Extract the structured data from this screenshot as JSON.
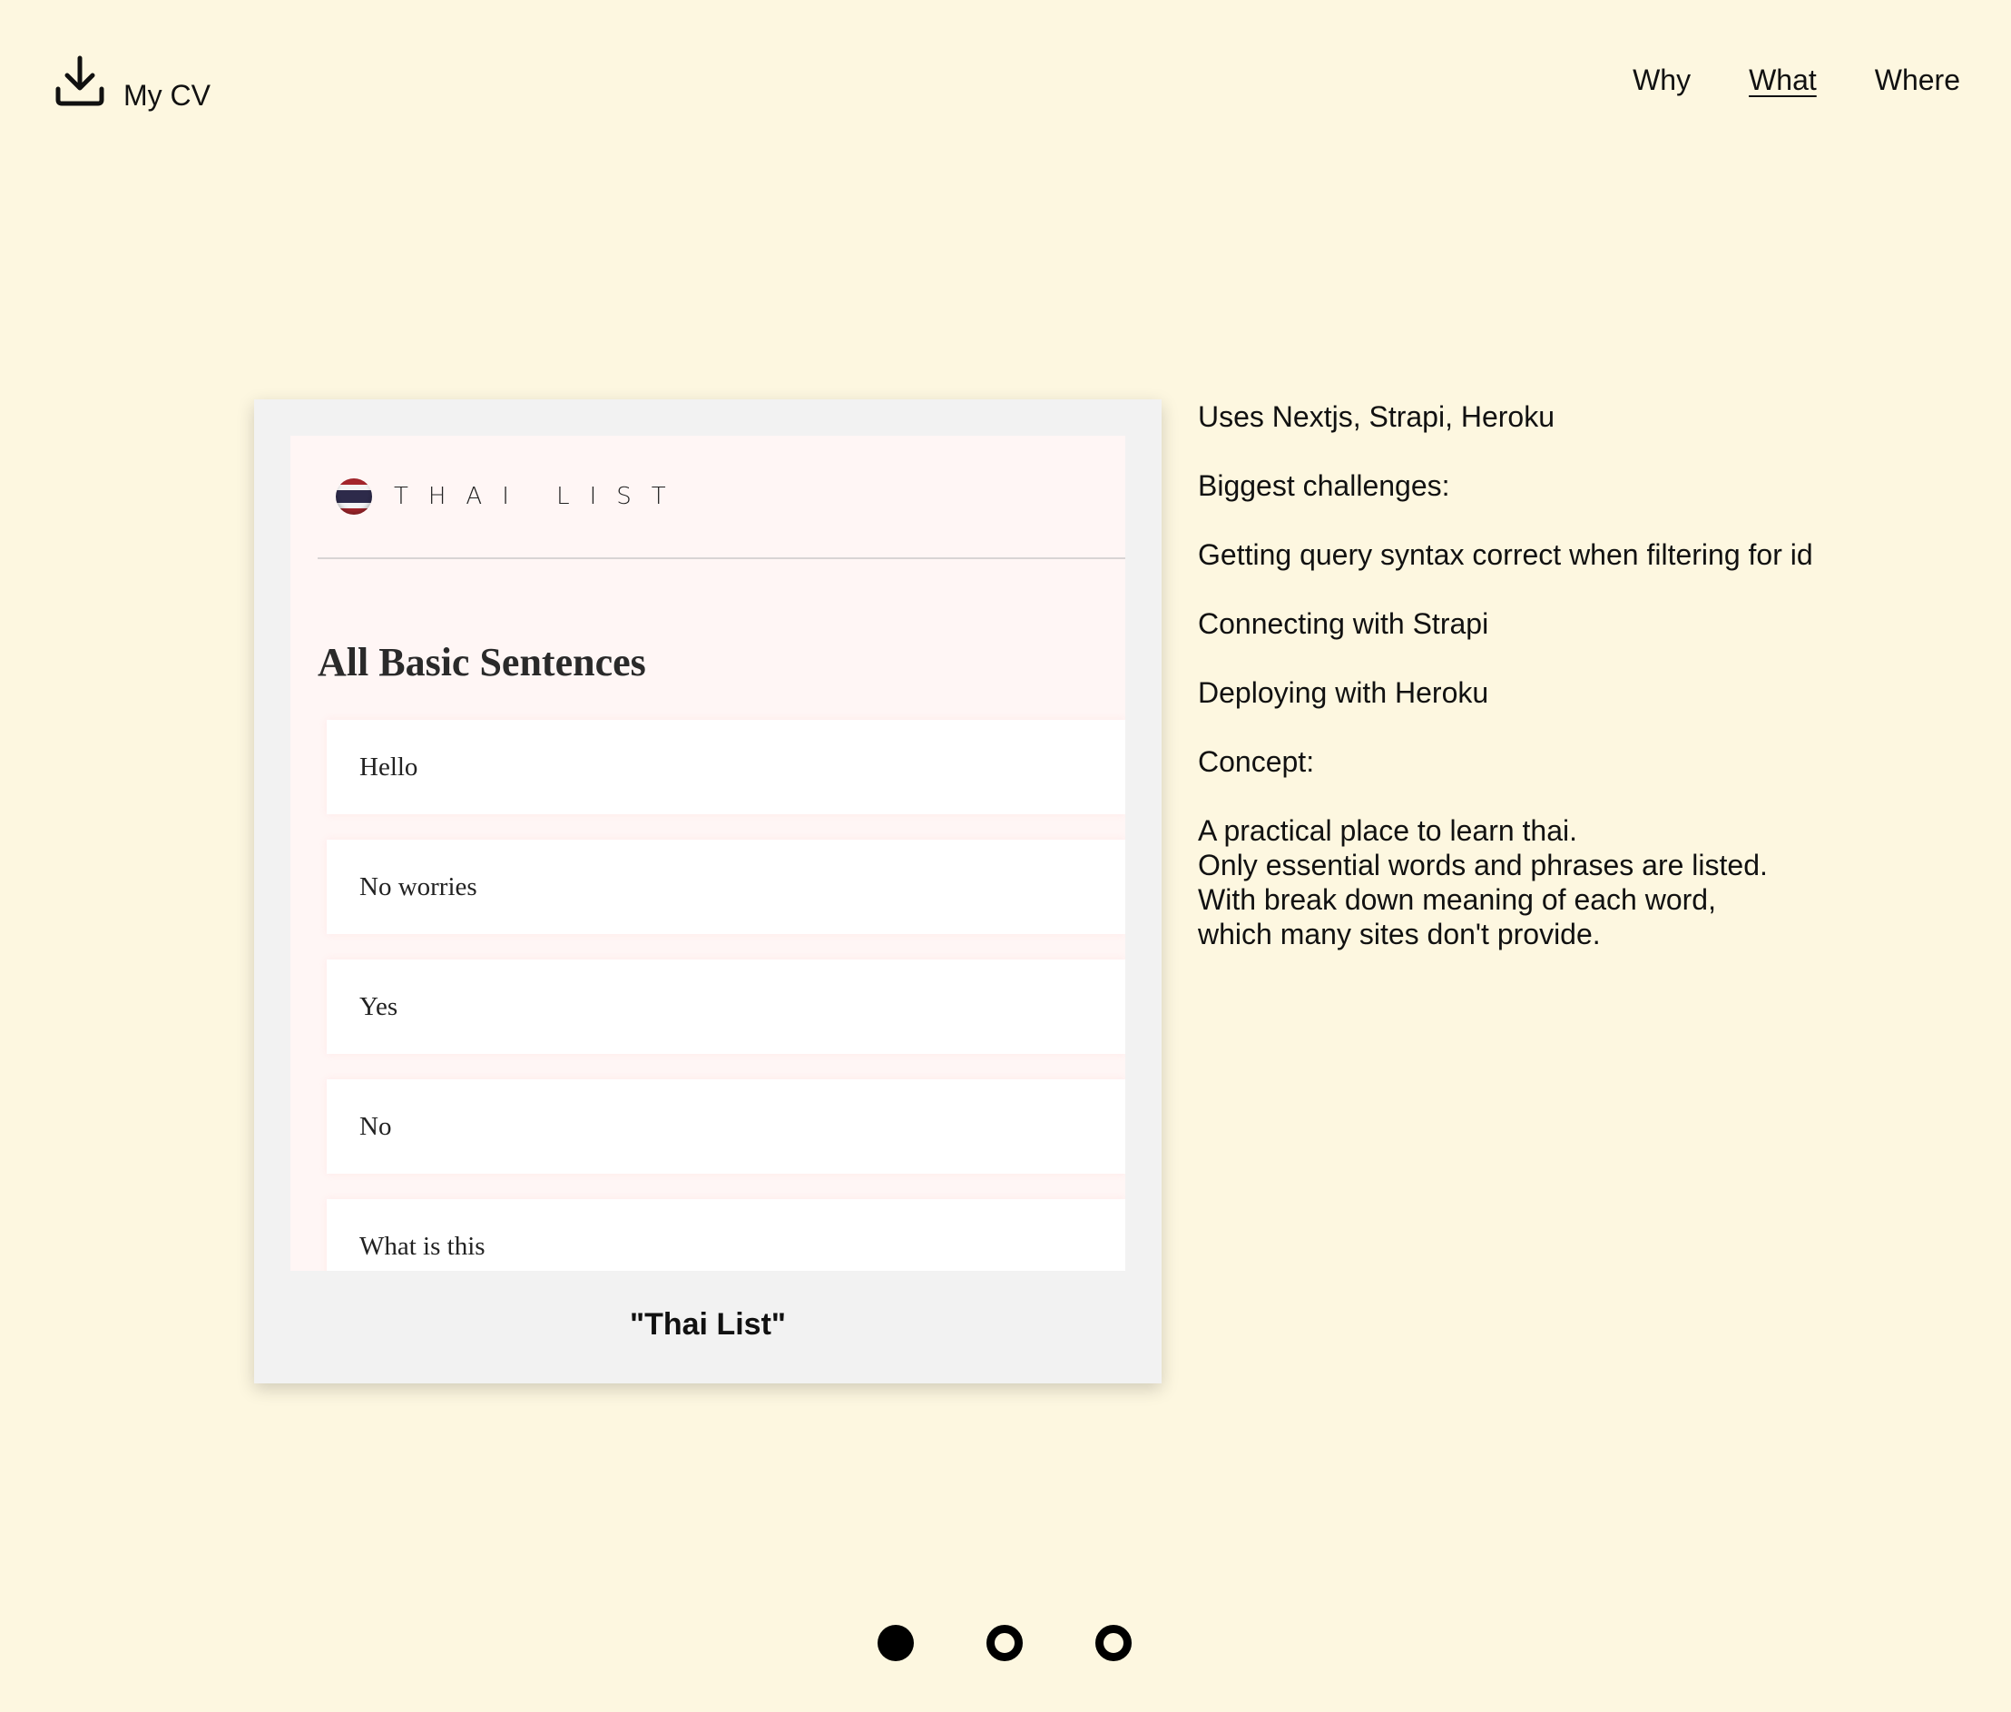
{
  "header": {
    "cv_label": "My CV",
    "cv_icon": "download-icon",
    "nav": [
      {
        "label": "Why",
        "active": false
      },
      {
        "label": "What",
        "active": true
      },
      {
        "label": "Where",
        "active": false
      }
    ]
  },
  "project": {
    "preview": {
      "flag_icon": "thai-flag-icon",
      "brand": "THAI LIST",
      "title": "All Basic Sentences",
      "sentences": [
        "Hello",
        "No worries",
        "Yes",
        "No",
        "What is this"
      ]
    },
    "caption": "\"Thai List\""
  },
  "description": {
    "uses": "Uses Nextjs, Strapi, Heroku",
    "challenges_heading": "Biggest challenges:",
    "challenges": [
      "Getting query syntax correct when filtering for id",
      "Connecting with Strapi",
      "Deploying with Heroku"
    ],
    "concept_heading": "Concept:",
    "concept_lines": [
      "A practical place to learn thai.",
      "Only essential words and phrases are listed.",
      "With break down meaning of each word,",
      "which many sites don't provide."
    ]
  },
  "pagination": {
    "active_index": 0,
    "count": 3
  },
  "colors": {
    "background": "#fdf7e0",
    "card": "#f2f2f2",
    "preview_bg": "#fff6f5"
  }
}
